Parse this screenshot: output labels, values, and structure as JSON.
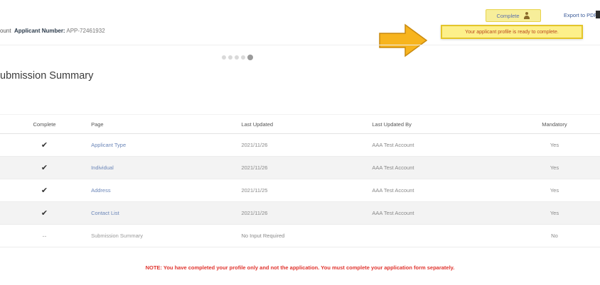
{
  "header": {
    "account_prefix": "ount",
    "applicant_number_label": "Applicant Number:",
    "applicant_number": "APP-72461932",
    "complete_label": "Complete",
    "export_label": "Export to PDF"
  },
  "tooltip": {
    "text": "Your applicant profile is ready to complete."
  },
  "stepper": {
    "total": 5,
    "current": 5
  },
  "page_title": "ubmission Summary",
  "table": {
    "headers": {
      "complete": "Complete",
      "page": "Page",
      "last_updated": "Last Updated",
      "last_updated_by": "Last Updated By",
      "mandatory": "Mandatory"
    },
    "rows": [
      {
        "complete": "✔",
        "page": "Applicant Type",
        "last_updated": "2021/11/26",
        "last_updated_by": "AAA Test Account",
        "mandatory": "Yes"
      },
      {
        "complete": "✔",
        "page": "Individual",
        "last_updated": "2021/11/26",
        "last_updated_by": "AAA Test Account",
        "mandatory": "Yes"
      },
      {
        "complete": "✔",
        "page": "Address",
        "last_updated": "2021/11/25",
        "last_updated_by": "AAA Test Account",
        "mandatory": "Yes"
      },
      {
        "complete": "✔",
        "page": "Contact List",
        "last_updated": "2021/11/26",
        "last_updated_by": "AAA Test Account",
        "mandatory": "Yes"
      },
      {
        "complete": "--",
        "page": "Submission Summary",
        "last_updated": "No Input Required",
        "last_updated_by": "",
        "mandatory": "No"
      }
    ]
  },
  "note": "NOTE: You have completed your profile only and not the application. You must complete your application form separately.",
  "colors": {
    "tooltip_bg": "#fdf08a",
    "tooltip_border": "#e4c52a",
    "arrow_fill": "#f7b41e",
    "note_red": "#e0342e",
    "link_blue": "#6b86b8"
  }
}
